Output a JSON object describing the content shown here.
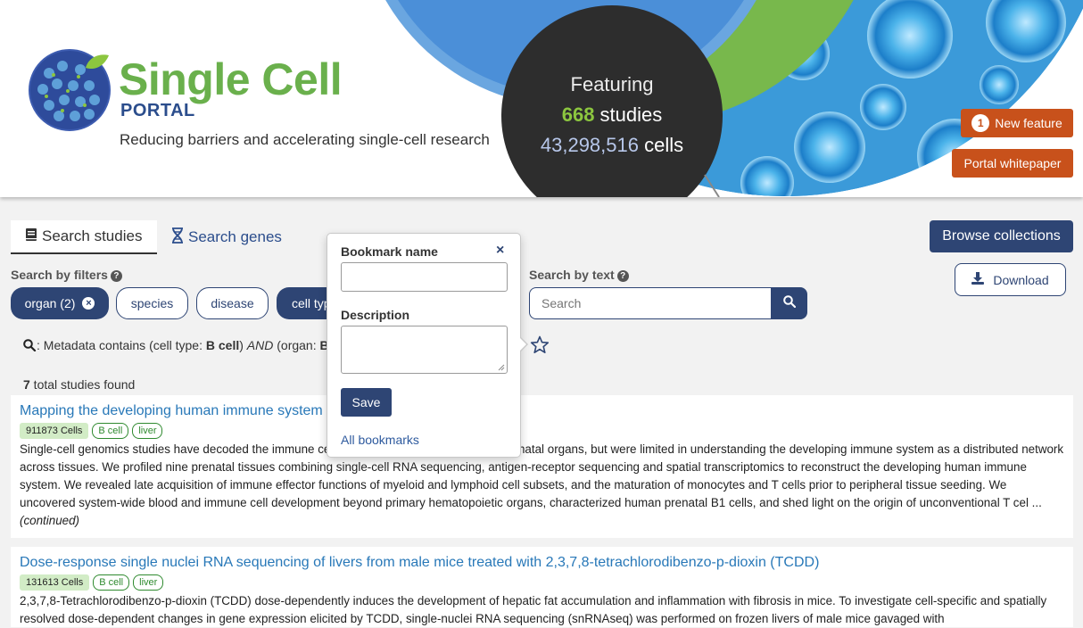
{
  "header": {
    "logo_title": "Single Cell",
    "logo_sub": "PORTAL",
    "tagline": "Reducing barriers and accelerating single-cell research",
    "featuring": "Featuring",
    "study_count": "668",
    "study_label": " studies",
    "cell_count": "43,298,516",
    "cell_label": " cells",
    "new_feature_count": "1",
    "new_feature_label": "New feature",
    "whitepaper_label": "Portal whitepaper"
  },
  "tabs": [
    {
      "label": "Search studies",
      "icon": "book-icon"
    },
    {
      "label": "Search genes",
      "icon": "dna-icon"
    }
  ],
  "actions": {
    "browse_label": "Browse collections",
    "download_label": "Download"
  },
  "filters": {
    "label": "Search by filters",
    "pills": [
      {
        "label": "organ (2)",
        "active": true
      },
      {
        "label": "species",
        "active": false
      },
      {
        "label": "disease",
        "active": false
      },
      {
        "label": "cell type",
        "active": true
      }
    ]
  },
  "text_search": {
    "label": "Search by text",
    "placeholder": "Search"
  },
  "metadata": {
    "prefix": ": Metadata contains (cell type: ",
    "cell_type": "B cell",
    "mid": ") ",
    "and": "AND",
    "organ_prefix": " (organ: ",
    "organ": "B"
  },
  "results": {
    "count": "7",
    "label": " total studies found",
    "items": [
      {
        "title": "Mapping the developing human immune system across organs",
        "cells": "911873 Cells",
        "tags": [
          "B cell",
          "liver"
        ],
        "description": "Single-cell genomics studies have decoded the immune cell composition of several human prenatal organs, but were limited in understanding the developing immune system as a distributed network across tissues. We profiled nine prenatal tissues combining single-cell RNA sequencing, antigen-receptor sequencing and spatial transcriptomics to reconstruct the developing human immune system. We revealed late acquisition of immune effector functions of myeloid and lymphoid cell subsets, and the maturation of monocytes and T cells prior to peripheral tissue seeding. We uncovered system-wide blood and immune cell development beyond primary hematopoietic organs, characterized human prenatal B1 cells, and shed light on the origin of unconventional T cel ...",
        "continued": "(continued)"
      },
      {
        "title": "Dose-response single nuclei RNA sequencing of livers from male mice treated with 2,3,7,8-tetrachlorodibenzo-p-dioxin (TCDD)",
        "cells": "131613 Cells",
        "tags": [
          "B cell",
          "liver"
        ],
        "description": "2,3,7,8-Tetrachlorodibenzo-p-dioxin (TCDD) dose-dependently induces the development of hepatic fat accumulation and inflammation with fibrosis in mice. To investigate cell-specific and spatially resolved dose-dependent changes in gene expression elicited by TCDD, single-nuclei RNA sequencing (snRNAseq) was performed on frozen livers of male mice gavaged with"
      }
    ]
  },
  "popover": {
    "name_label": "Bookmark name",
    "description_label": "Description",
    "save_label": "Save",
    "all_bookmarks_label": "All bookmarks",
    "close_symbol": "×"
  },
  "colors": {
    "navy": "#2e4574",
    "orange": "#c8511b",
    "green": "#6ab04c",
    "link": "#2878b8"
  }
}
